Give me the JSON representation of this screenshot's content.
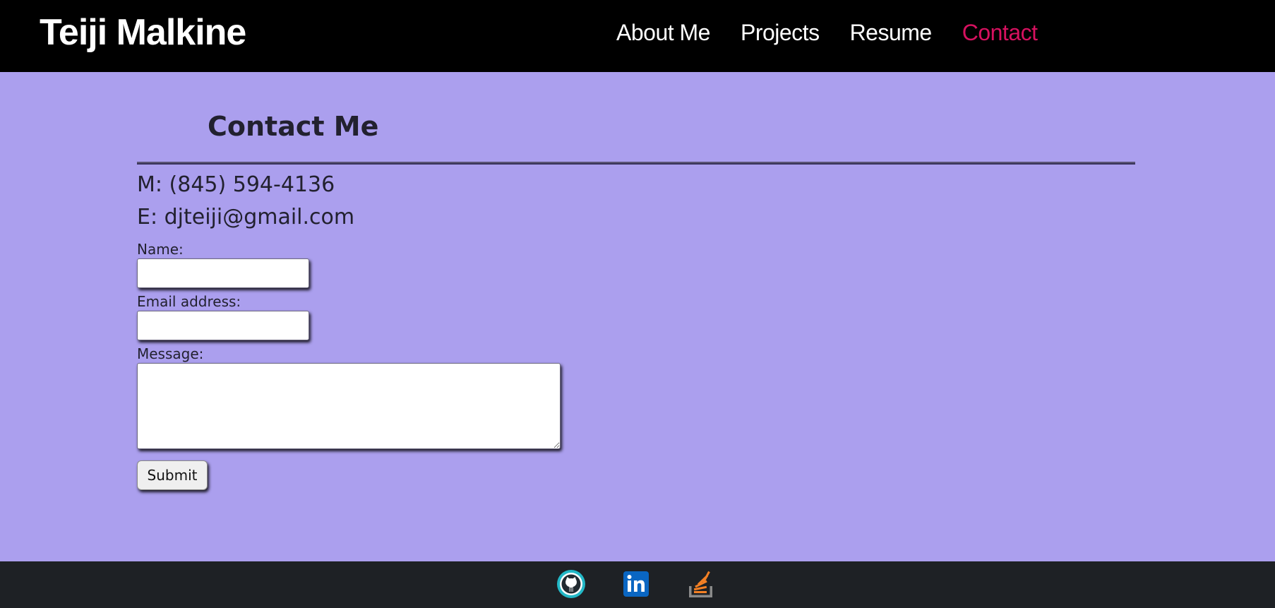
{
  "header": {
    "brand": "Teiji Malkine",
    "nav": [
      {
        "label": "About Me",
        "active": false
      },
      {
        "label": "Projects",
        "active": false
      },
      {
        "label": "Resume",
        "active": false
      },
      {
        "label": "Contact",
        "active": true
      }
    ],
    "active_color": "#d6115f"
  },
  "main": {
    "title": "Contact Me",
    "phone": "M: (845) 594-4136",
    "email": "E: djteiji@gmail.com",
    "form": {
      "name_label": "Name:",
      "name_value": "",
      "email_label": "Email address:",
      "email_value": "",
      "message_label": "Message:",
      "message_value": "",
      "submit_label": "Submit"
    },
    "background_color": "#ab9fee"
  },
  "footer": {
    "icons": [
      "github-icon",
      "linkedin-icon",
      "stackoverflow-icon"
    ],
    "background_color": "#1e2125"
  }
}
